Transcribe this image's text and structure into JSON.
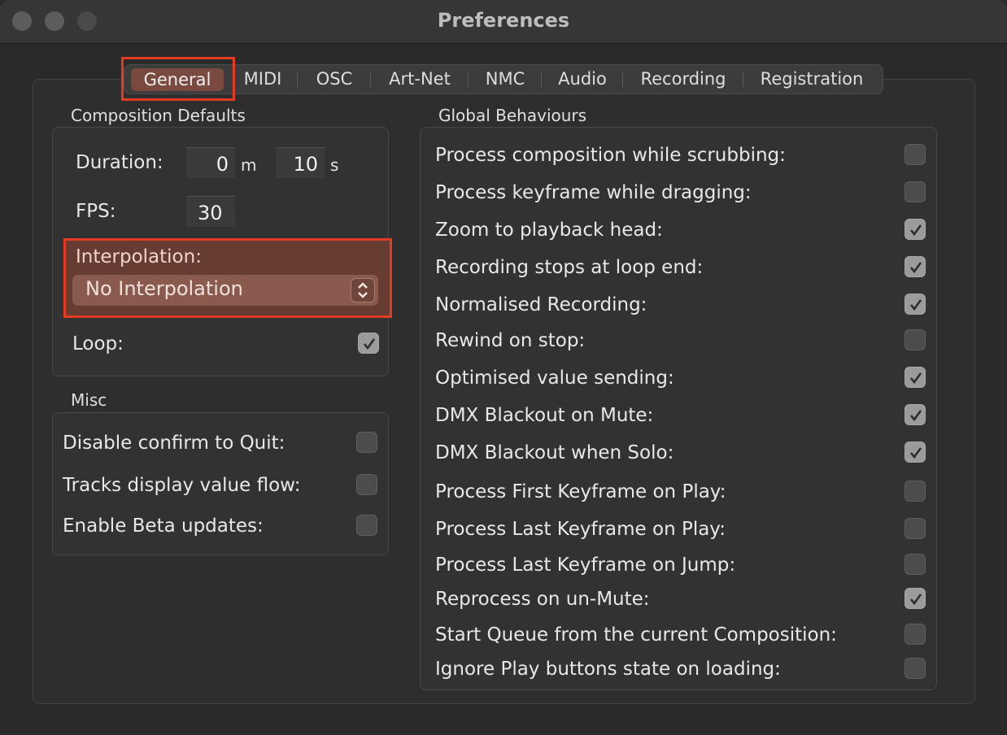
{
  "window": {
    "title": "Preferences"
  },
  "tabs": [
    {
      "label": "General"
    },
    {
      "label": "MIDI"
    },
    {
      "label": "OSC"
    },
    {
      "label": "Art-Net"
    },
    {
      "label": "NMC"
    },
    {
      "label": "Audio"
    },
    {
      "label": "Recording"
    },
    {
      "label": "Registration"
    }
  ],
  "composition_defaults": {
    "title": "Composition Defaults",
    "duration_label": "Duration:",
    "duration_minutes": "0",
    "minutes_unit": "m",
    "duration_seconds": "10",
    "seconds_unit": "s",
    "fps_label": "FPS:",
    "fps_value": "30",
    "interpolation_label": "Interpolation:",
    "interpolation_value": "No Interpolation",
    "loop_label": "Loop:",
    "loop_checked": true
  },
  "misc": {
    "title": "Misc",
    "items": [
      {
        "label": "Disable confirm to Quit:",
        "checked": false
      },
      {
        "label": "Tracks display value flow:",
        "checked": false
      },
      {
        "label": "Enable Beta updates:",
        "checked": false
      }
    ]
  },
  "global_behaviours": {
    "title": "Global Behaviours",
    "items": [
      {
        "label": "Process composition while scrubbing:",
        "checked": false
      },
      {
        "label": "Process keyframe while dragging:",
        "checked": false
      },
      {
        "label": "Zoom to playback head:",
        "checked": true
      },
      {
        "label": "Recording stops at loop end:",
        "checked": true
      },
      {
        "label": "Normalised Recording:",
        "checked": true
      },
      {
        "label": "Rewind on stop:",
        "checked": false
      },
      {
        "label": "Optimised value sending:",
        "checked": true
      },
      {
        "label": "DMX Blackout on Mute:",
        "checked": true
      },
      {
        "label": "DMX Blackout when Solo:",
        "checked": true
      },
      {
        "label": "Process First Keyframe on Play:",
        "checked": false
      },
      {
        "label": "Process Last Keyframe on Play:",
        "checked": false
      },
      {
        "label": "Process Last Keyframe on Jump:",
        "checked": false
      },
      {
        "label": "Reprocess on un-Mute:",
        "checked": true
      },
      {
        "label": "Start Queue from the current Composition:",
        "checked": false
      },
      {
        "label": "Ignore Play buttons state on loading:",
        "checked": false
      }
    ]
  },
  "colors": {
    "highlight": "#e53b22",
    "active_tab": "#7a4a40"
  }
}
